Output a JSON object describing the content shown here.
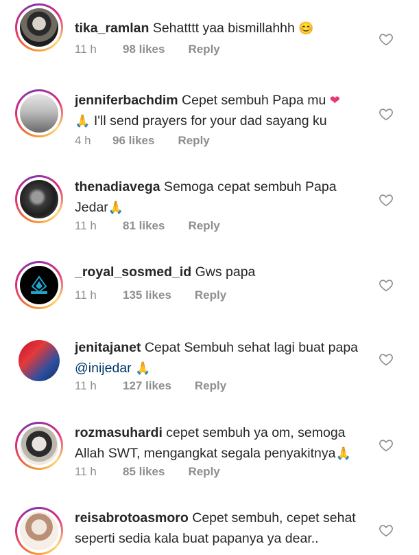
{
  "comments": [
    {
      "user": "tika_ramlan",
      "text": " Sehatttt yaa bismillahhh ",
      "emoji": "😊",
      "time": "11 h",
      "likes": "98 likes",
      "reply": "Reply"
    },
    {
      "user": "jenniferbachdim",
      "text": " Cepet sembuh Papa mu ",
      "emoji": "❤",
      "line2_emoji": "🙏",
      "line2": " I'll send prayers for your dad sayang ku",
      "time": "4 h",
      "likes": "96 likes",
      "reply": "Reply"
    },
    {
      "user": "thenadiavega",
      "text": " Semoga cepat sembuh Papa",
      "line2": "Jedar",
      "line2_emoji": "🙏",
      "time": "11 h",
      "likes": "81 likes",
      "reply": "Reply"
    },
    {
      "user": "_royal_sosmed_id",
      "text": " Gws papa",
      "time": "11 h",
      "likes": "135 likes",
      "reply": "Reply"
    },
    {
      "user": "jenitajanet",
      "text": " Cepat Sembuh sehat lagi buat papa",
      "mention": "@inijedar",
      "line2_emoji": "🙏",
      "time": "11 h",
      "likes": "127 likes",
      "reply": "Reply"
    },
    {
      "user": "rozmasuhardi",
      "text": " cepet sembuh ya om, semoga",
      "line2": "Allah SWT, mengangkat segala penyakitnya",
      "line2_emoji": "🙏",
      "time": "11 h",
      "likes": "85 likes",
      "reply": "Reply"
    },
    {
      "user": "reisabrotoasmoro",
      "text": " Cepet sembuh, cepet sehat",
      "line2": "seperti sedia kala buat papanya ya dear.."
    }
  ],
  "icons": {
    "like": "heart-outline-icon"
  },
  "colors": {
    "ring_start": "#f58529",
    "ring_mid": "#dd2a7b",
    "ring_end": "#8134af",
    "mention": "#00376b",
    "meta": "#8e8e8e"
  }
}
